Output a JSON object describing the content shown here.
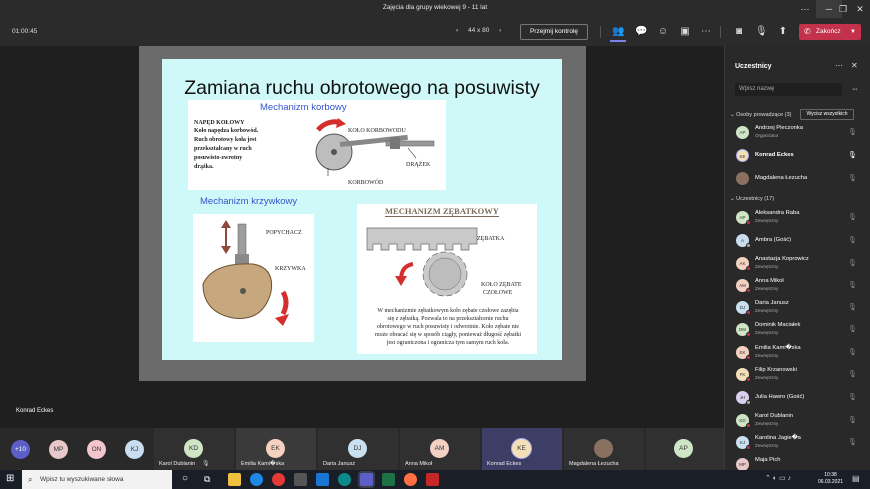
{
  "window": {
    "title": "Zajęcia dla grupy wiekowej 9 - 11 lat"
  },
  "meeting": {
    "timer": "01:00:45",
    "zoom_level": "44 x 80",
    "take_control_label": "Przejmij kontrolę",
    "end_label": "Zakończ"
  },
  "slide": {
    "title": "Zamiana ruchu obrotowego na posuwisty",
    "crank": {
      "heading": "Mechanizm korbowy",
      "text": [
        "NAPĘD KOŁOWY",
        "Koło napędza korbowód.",
        "Ruch obrotowy koła jest",
        "przekształcany w ruch",
        "posuwisto-zwrotny",
        "drążka."
      ],
      "label_wheel": "KOŁO KORBOWODU",
      "label_rod": "DRĄŻEK",
      "label_conrod": "KORBOWÓD"
    },
    "cam": {
      "heading": "Mechanizm krzywkowy",
      "label_pusher": "POPYCHACZ",
      "label_cam": "KRZYWKA"
    },
    "rack": {
      "heading": "MECHANIZM ZĘBATKOWY",
      "label_rack": "ZĘBATKA",
      "label_gear_1": "KOŁO ZĘBATE",
      "label_gear_2": "CZOŁOWE",
      "text": [
        "W mechanizmie zębatkowym koło zębate czołowe zazębia",
        "się z zębatką. Pozwala to na przekształcenie ruchu",
        "obrotowego w ruch posuwisty i odwrotnie. Koło zębate nie",
        "może obracać się w sposób ciągły, ponieważ długość zębatki",
        "jest ograniczona i ogranicza tym samym ruch koła."
      ]
    }
  },
  "presenter_label": "Konrad Eckes",
  "strip": {
    "overflow": "+10",
    "avatars": [
      {
        "initials": "MP",
        "color": "#e8c8c8"
      },
      {
        "initials": "ON",
        "color": "#f3c6cf"
      },
      {
        "initials": "KJ",
        "color": "#c8def0"
      }
    ],
    "tiles": [
      {
        "initials": "KD",
        "name": "Karol Dublanin",
        "color": "#cfe6c6"
      },
      {
        "initials": "EK",
        "name": "Emilia Kami�ska",
        "color": "#f5d2c0"
      },
      {
        "initials": "DJ",
        "name": "Daria Janusz",
        "color": "#c8e0f0"
      },
      {
        "initials": "AM",
        "name": "Anna Mikoł",
        "color": "#f3d2c4"
      },
      {
        "initials": "KE",
        "name": "Konrad Eckes",
        "color": "#f3e0b8"
      },
      {
        "initials": "",
        "name": "Magdalena Łezucha",
        "color": "#8a7060"
      },
      {
        "initials": "AP",
        "name": "",
        "color": "#cfe6c6"
      }
    ]
  },
  "participants_panel": {
    "title": "Uczestnicy",
    "search_placeholder": "Wpisz nazwę",
    "presenters_section": "Osoby prowadzące (3)",
    "show_all": "Wycisz wszystkich",
    "presenters": [
      {
        "initials": "AP",
        "name": "Andrzej Pieczonka",
        "role": "Organizator",
        "color": "#cfe6c6",
        "mic": "muted"
      },
      {
        "initials": "KE",
        "name": "Konrad Eckes",
        "role": "",
        "color": "#f3e0b8",
        "mic": "on"
      },
      {
        "initials": "",
        "name": "Magdalena Łezucha",
        "role": "",
        "color": "#8a7060",
        "mic": "muted"
      }
    ],
    "attendees_section": "Uczestnicy (17)",
    "attendees": [
      {
        "initials": "AP",
        "name": "Aleksandra Raba",
        "role": "Zewnętrzny",
        "color": "#cfe6c6"
      },
      {
        "initials": "A",
        "name": "Ambra (Gość)",
        "role": "",
        "color": "#c8def0"
      },
      {
        "initials": "AK",
        "name": "Anastazja Koprowicz",
        "role": "Zewnętrzny",
        "color": "#f5d2c0"
      },
      {
        "initials": "AM",
        "name": "Anna Mikoł",
        "role": "Zewnętrzny",
        "color": "#f3d2c4"
      },
      {
        "initials": "DJ",
        "name": "Daria Janusz",
        "role": "Zewnętrzny",
        "color": "#c8e0f0"
      },
      {
        "initials": "DM",
        "name": "Dominik Maciałek",
        "role": "Zewnętrzny",
        "color": "#cfe6c6"
      },
      {
        "initials": "EK",
        "name": "Emilia Kami�ska",
        "role": "Zewnętrzny",
        "color": "#f5d2c0"
      },
      {
        "initials": "FK",
        "name": "Filip Krzanowski",
        "role": "Zewnętrzny",
        "color": "#f3e0b8"
      },
      {
        "initials": "JH",
        "name": "Julia Hawro (Gość)",
        "role": "",
        "color": "#d8d0f0"
      },
      {
        "initials": "KD",
        "name": "Karol Dublanin",
        "role": "Zewnętrzny",
        "color": "#cfe6c6"
      },
      {
        "initials": "KJ",
        "name": "Karolina Jagie�a",
        "role": "Zewnętrzny",
        "color": "#c8e0f0"
      },
      {
        "initials": "MP",
        "name": "Maja Pich",
        "role": "",
        "color": "#e8c8c8"
      }
    ]
  },
  "taskbar": {
    "search_placeholder": "Wpisz tu wyszukiwane słowa",
    "time": "10:38",
    "date": "06.03.2021"
  }
}
